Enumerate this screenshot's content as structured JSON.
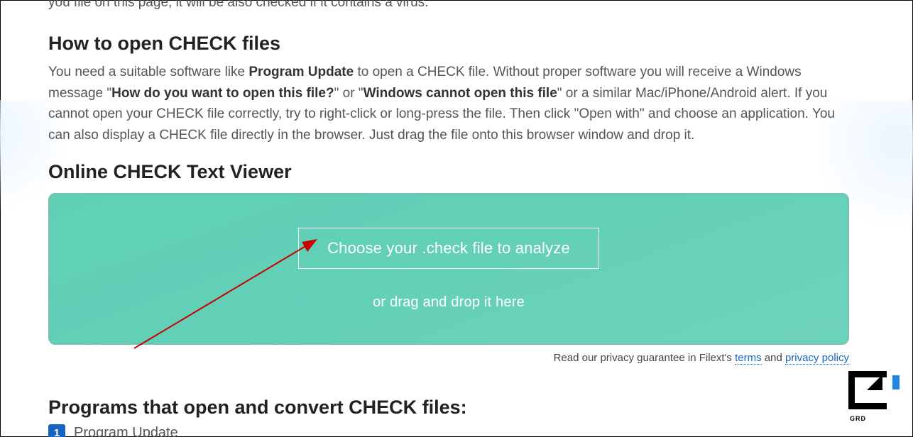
{
  "top_partial": "you file on this page, it will be also checked if it contains a virus.",
  "section1": {
    "heading": "How to open CHECK files",
    "p_part1": "You need a suitable software like ",
    "p_bold1": "Program Update",
    "p_part2": " to open a CHECK file. Without proper software you will receive a Windows message \"",
    "p_bold2": "How do you want to open this file?",
    "p_part3": "\" or \"",
    "p_bold3": "Windows cannot open this file",
    "p_part4": "\" or a similar Mac/iPhone/Android alert. If you cannot open your CHECK file correctly, try to right-click or long-press the file. Then click \"Open with\" and choose an application. You can also display a CHECK file directly in the browser. Just drag the file onto this browser window and drop it."
  },
  "viewer": {
    "heading": "Online CHECK Text Viewer",
    "choose_label": "Choose your .check file to analyze",
    "drag_label": "or drag and drop it here"
  },
  "privacy": {
    "prefix": "Read our privacy guarantee in Filext's ",
    "terms": "terms",
    "and": " and ",
    "policy": "privacy policy"
  },
  "programs": {
    "heading": "Programs that open and convert CHECK files:",
    "items": [
      {
        "num": "1",
        "name": "Program Update"
      }
    ]
  },
  "watermark_text": "GRD"
}
